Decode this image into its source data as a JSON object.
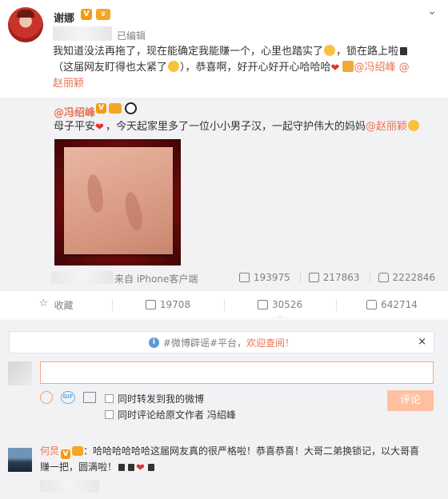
{
  "post": {
    "author": "谢娜",
    "edited_label": "已编辑",
    "text_line1": "我知道没法再拖了，现在能确定我能赚一个，心里也踏实了",
    "text_line1b": "，锁在路上啦",
    "text_line2a": "（这届网友盯得也太紧了",
    "text_line2b": "），恭喜啊，好开心好开心哈哈哈",
    "mention1": "@冯绍峰",
    "mention_at": " @",
    "mention2": "赵丽颖"
  },
  "repost": {
    "author": "@冯绍峰",
    "text_a": "母子平安",
    "text_b": "，今天起家里多了一位小小男子汉，一起守护伟大的妈妈",
    "mention": "@赵丽颖",
    "source": "来自 iPhone客户端",
    "stats": {
      "forward": "193975",
      "comment": "217863",
      "like": "2222846"
    }
  },
  "actions": {
    "favorite": "收藏",
    "forward": "19708",
    "comment": "30526",
    "like": "642714"
  },
  "comment_box": {
    "notice_text": "#微博辟谣#平台，",
    "notice_link": "欢迎查阅！",
    "close": "×",
    "opt1": "同时转发到我的微博",
    "opt2": "同时评论给原文作者 冯绍峰",
    "submit": "评论"
  },
  "first_comment": {
    "author": "何炅",
    "text": "：哈哈哈哈哈哈这届网友真的很严格啦！恭喜恭喜！大哥二弟换锁记，以大哥喜",
    "text2": "赚一把，圆满啦！"
  }
}
